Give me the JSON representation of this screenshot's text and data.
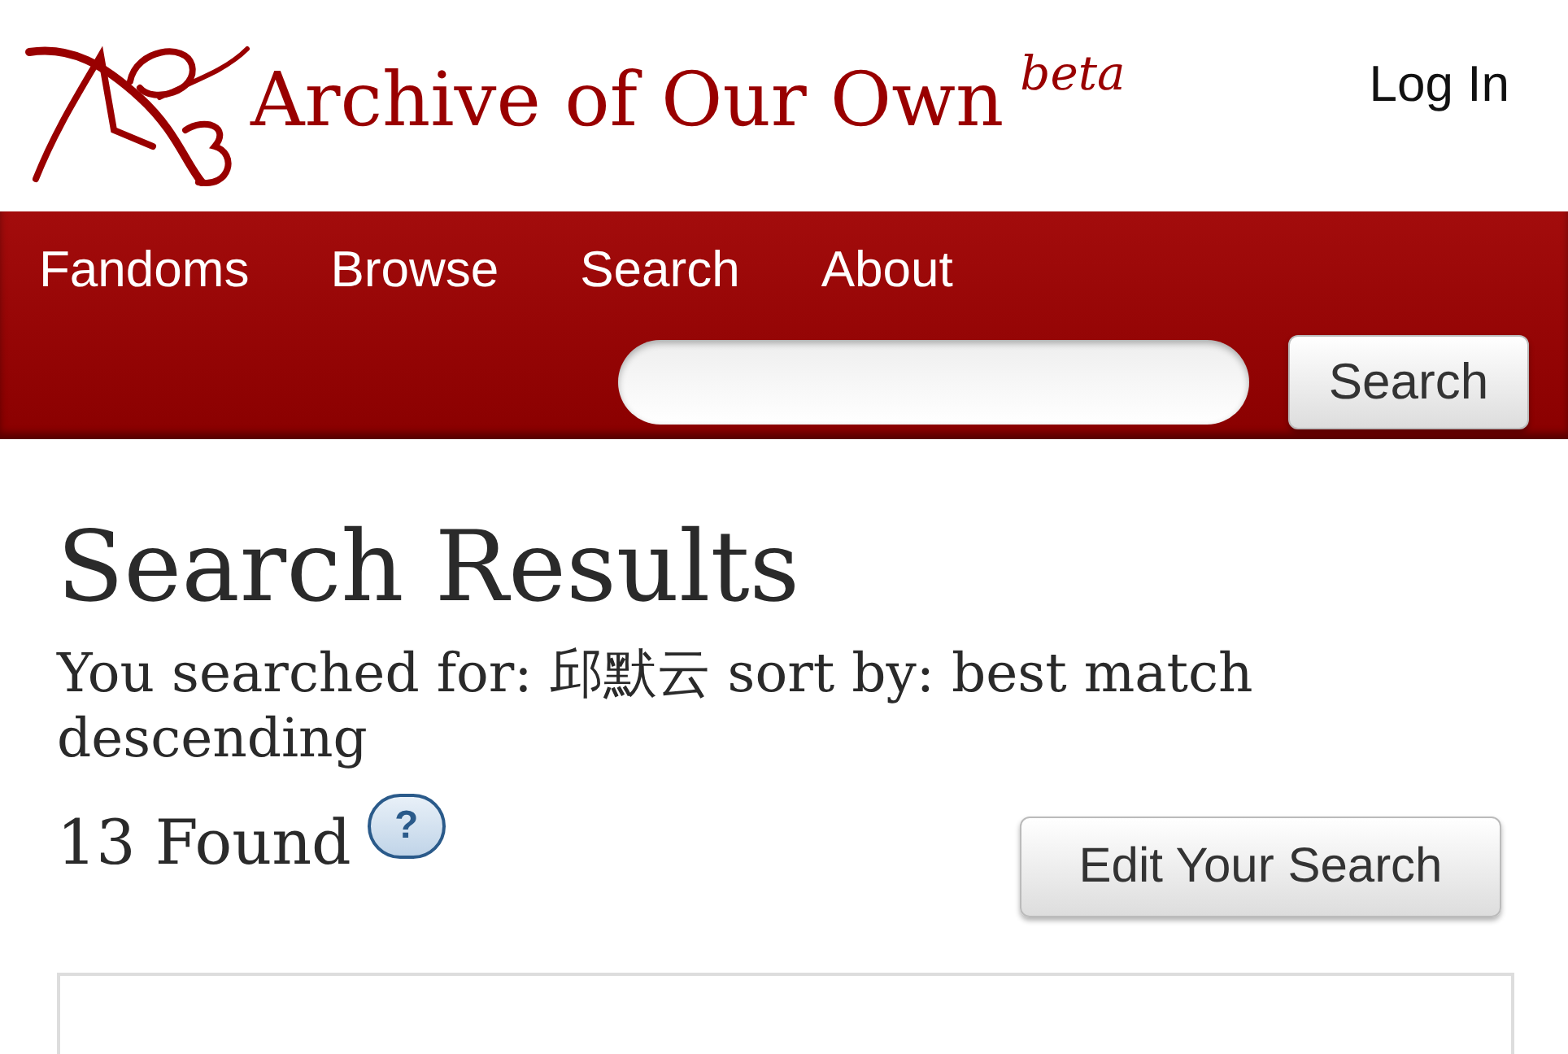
{
  "header": {
    "title": "Archive of Our Own",
    "badge": "beta",
    "login": "Log In"
  },
  "nav": {
    "items": [
      {
        "label": "Fandoms"
      },
      {
        "label": "Browse"
      },
      {
        "label": "Search"
      },
      {
        "label": "About"
      }
    ],
    "search_button": "Search"
  },
  "main": {
    "heading": "Search Results",
    "summary": "You searched for: 邱默云 sort by: best match descending",
    "count": "13 Found",
    "help": "?",
    "edit_button": "Edit Your Search"
  }
}
